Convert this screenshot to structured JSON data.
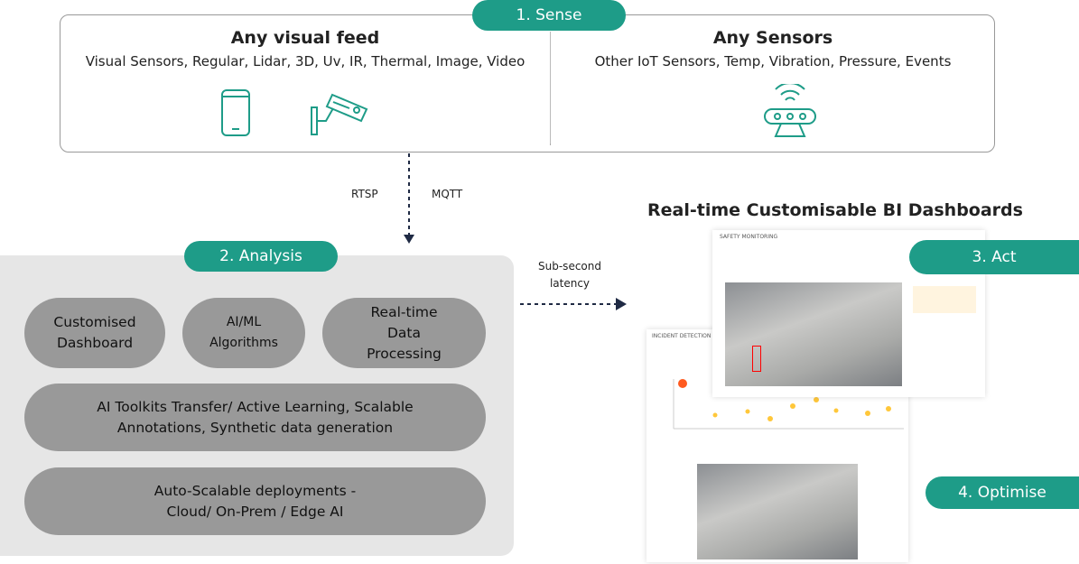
{
  "sense": {
    "badge": "1. Sense",
    "visual": {
      "title": "Any visual feed",
      "subtitle": "Visual Sensors, Regular, Lidar, 3D, Uv, IR, Thermal, Image, Video",
      "icons": [
        "smartphone-icon",
        "cctv-camera-icon"
      ]
    },
    "sensors": {
      "title": "Any Sensors",
      "subtitle": "Other IoT Sensors, Temp, Vibration, Pressure, Events",
      "icons": [
        "iot-sensor-icon"
      ]
    }
  },
  "protocols": {
    "left": "RTSP",
    "right": "MQTT"
  },
  "analysis": {
    "badge": "2. Analysis",
    "items": [
      "Customised Dashboard",
      "AI/ML Algorithms",
      "Real-time Data Processing",
      "AI Toolkits Transfer/ Active Learning, Scalable Annotations, Synthetic data generation",
      "Auto-Scalable deployments - Cloud/ On-Prem / Edge AI"
    ]
  },
  "latency": "Sub-second latency",
  "dashboards": {
    "title": "Real-time Customisable BI Dashboards",
    "safety": "SAFETY MONITORING",
    "incident": "INCIDENT DETECTION"
  },
  "act": "3. Act",
  "optimise": "4. Optimise",
  "colors": {
    "accent": "#1e9c88",
    "grey_pill": "#999999",
    "panel": "#e6e6e6",
    "arrow": "#1f2a44"
  }
}
